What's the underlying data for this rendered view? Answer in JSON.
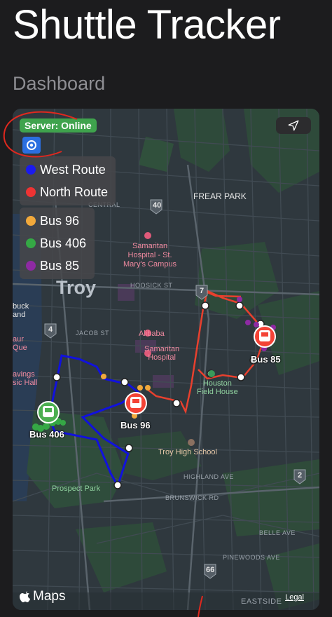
{
  "app": {
    "title": "Shuttle Tracker"
  },
  "section": {
    "title": "Dashboard"
  },
  "map": {
    "server_status": "Server: Online",
    "recenter_icon": "target-icon",
    "location_icon": "location-arrow-icon",
    "routes_legend": [
      {
        "label": "West Route",
        "color": "#1a1aee"
      },
      {
        "label": "North Route",
        "color": "#ee3333"
      }
    ],
    "buses_legend": [
      {
        "label": "Bus 96",
        "color": "#f2a93b"
      },
      {
        "label": "Bus 406",
        "color": "#35a845"
      },
      {
        "label": "Bus 85",
        "color": "#8e2aa3"
      }
    ],
    "buses": [
      {
        "label": "Bus 96",
        "color": "#f44336"
      },
      {
        "label": "Bus 406",
        "color": "#4caf50"
      },
      {
        "label": "Bus 85",
        "color": "#f44336"
      }
    ],
    "labels": {
      "troy": "Troy",
      "frear_park": "FREAR PARK",
      "hospital_st_marys": "Samaritan\nHospital - St.\nMary's Campus",
      "hoosick_st": "HOOSICK ST",
      "alibaba": "Alibaba",
      "samaritan_hospital": "Samaritan\nHospital",
      "houston_field_house": "Houston\nField House",
      "troy_high_school": "Troy High School",
      "prospect_park": "Prospect Park",
      "brunswick_rd": "BRUNSWICK RD",
      "highland_ave": "HIGHLAND AVE",
      "pinewoods_ave": "PINEWOODS AVE",
      "belle_ave": "BELLE AVE",
      "eastside": "EASTSIDE",
      "jacob_st": "JACOB ST",
      "central": "CENTRAL",
      "savings_music_hall": "avings\nsic Hall",
      "taur_que": "aur\nQue",
      "tbuck": "buck\nand",
      "route_40": "40",
      "route_7": "7",
      "route_4": "4",
      "route_2": "2",
      "route_66": "66"
    },
    "maps_brand": "Maps",
    "legal": "Legal"
  }
}
